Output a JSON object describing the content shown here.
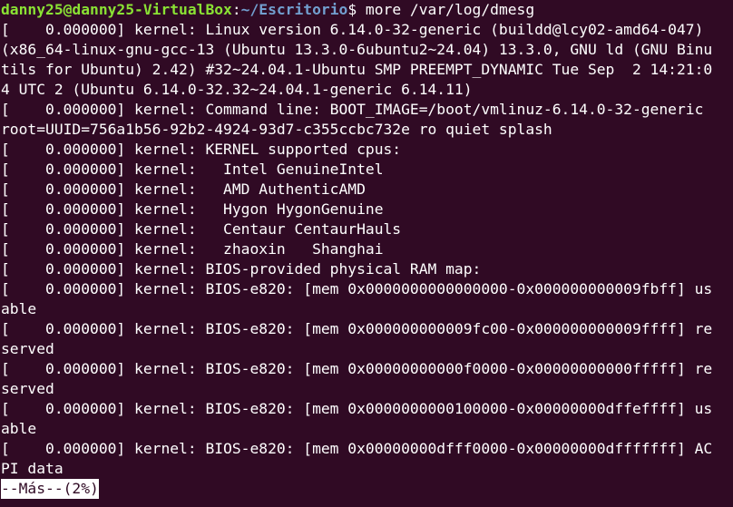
{
  "prompt": {
    "user_host": "danny25@danny25-VirtualBox",
    "separator": ":",
    "path": "~/Escritorio",
    "symbol": "$ ",
    "command": "more /var/log/dmesg"
  },
  "output_lines": [
    "[    0.000000] kernel: Linux version 6.14.0-32-generic (buildd@lcy02-amd64-047)",
    "(x86_64-linux-gnu-gcc-13 (Ubuntu 13.3.0-6ubuntu2~24.04) 13.3.0, GNU ld (GNU Binu",
    "tils for Ubuntu) 2.42) #32~24.04.1-Ubuntu SMP PREEMPT_DYNAMIC Tue Sep  2 14:21:0",
    "4 UTC 2 (Ubuntu 6.14.0-32.32~24.04.1-generic 6.14.11)",
    "[    0.000000] kernel: Command line: BOOT_IMAGE=/boot/vmlinuz-6.14.0-32-generic",
    "root=UUID=756a1b56-92b2-4924-93d7-c355ccbc732e ro quiet splash",
    "[    0.000000] kernel: KERNEL supported cpus:",
    "[    0.000000] kernel:   Intel GenuineIntel",
    "[    0.000000] kernel:   AMD AuthenticAMD",
    "[    0.000000] kernel:   Hygon HygonGenuine",
    "[    0.000000] kernel:   Centaur CentaurHauls",
    "[    0.000000] kernel:   zhaoxin   Shanghai",
    "[    0.000000] kernel: BIOS-provided physical RAM map:",
    "[    0.000000] kernel: BIOS-e820: [mem 0x0000000000000000-0x000000000009fbff] us",
    "able",
    "[    0.000000] kernel: BIOS-e820: [mem 0x000000000009fc00-0x000000000009ffff] re",
    "served",
    "[    0.000000] kernel: BIOS-e820: [mem 0x00000000000f0000-0x00000000000fffff] re",
    "served",
    "[    0.000000] kernel: BIOS-e820: [mem 0x0000000000100000-0x00000000dffeffff] us",
    "able",
    "[    0.000000] kernel: BIOS-e820: [mem 0x00000000dfff0000-0x00000000dfffffff] AC",
    "PI data"
  ],
  "pager": {
    "status": "--Más--(2%)"
  },
  "colors": {
    "background": "#300a24",
    "foreground": "#ffffff",
    "prompt_user": "#8ae234",
    "prompt_path": "#729fcf"
  }
}
